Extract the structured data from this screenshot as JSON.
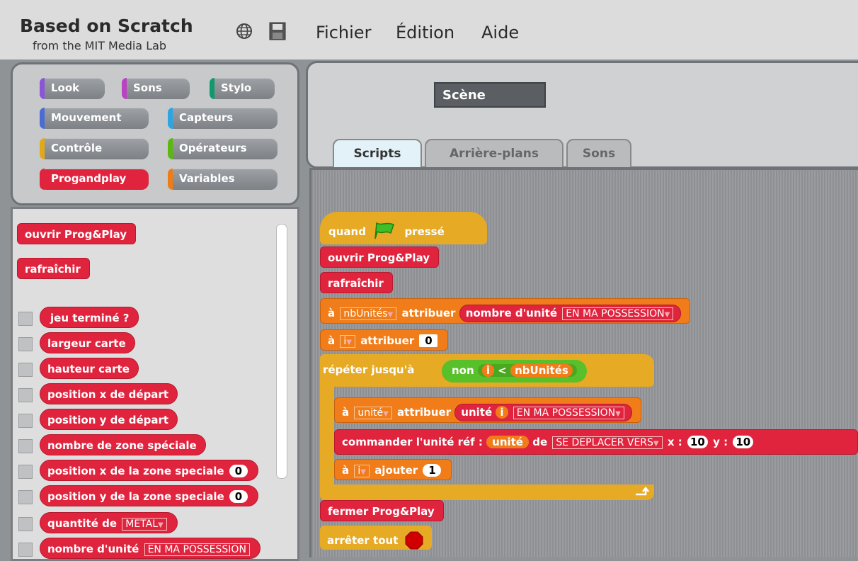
{
  "header": {
    "title": "Based on Scratch",
    "subtitle": "from the MIT Media Lab",
    "menus": [
      "Fichier",
      "Édition",
      "Aide"
    ]
  },
  "categories": [
    {
      "label": "Look",
      "color": "#8a55d7"
    },
    {
      "label": "Sons",
      "color": "#bb42c3"
    },
    {
      "label": "Stylo",
      "color": "#0e9a6c"
    },
    {
      "label": "Mouvement",
      "color": "#4a6cd4"
    },
    {
      "label": "Capteurs",
      "color": "#2ca5e2"
    },
    {
      "label": "Contrôle",
      "color": "#e1a91a"
    },
    {
      "label": "Opérateurs",
      "color": "#5cb712"
    },
    {
      "label": "Progandplay",
      "color": "#e0243e",
      "selected": true
    },
    {
      "label": "Variables",
      "color": "#ee7d16"
    }
  ],
  "palette": {
    "commands": [
      "ouvrir Prog&Play",
      "rafraîchir"
    ],
    "reporters": [
      "jeu terminé ?",
      "largeur carte",
      "hauteur carte",
      "position x de départ",
      "position y de départ",
      "nombre de zone spéciale",
      "position x de la zone speciale",
      "position y de la zone speciale",
      "quantité de",
      "nombre d'unité"
    ],
    "zero": "0",
    "metal": "METAL",
    "possession": "EN MA POSSESSION"
  },
  "sprite": {
    "name": "Scène"
  },
  "tabs": [
    "Scripts",
    "Arrière-plans",
    "Sons"
  ],
  "script": {
    "hat_when": "quand",
    "hat_pressed": "pressé",
    "open": "ouvrir Prog&Play",
    "refresh": "rafraîchir",
    "to": "à",
    "var_nb": "nbUnités",
    "var_i": "i",
    "var_unit": "unité",
    "set": "attribuer",
    "count_units": "nombre d'unité",
    "possession": "EN MA POSSESSION",
    "zero": "0",
    "repeat_until": "répéter jusqu'à",
    "not": "non",
    "lt": "<",
    "unit": "unité",
    "command": "commander l'unité réf :",
    "of": "de",
    "move_to": "SE DEPLACER VERS",
    "x": "x :",
    "y": "y :",
    "ten": "10",
    "add": "ajouter",
    "one": "1",
    "close": "fermer Prog&Play",
    "stop_all": "arrêter tout"
  }
}
